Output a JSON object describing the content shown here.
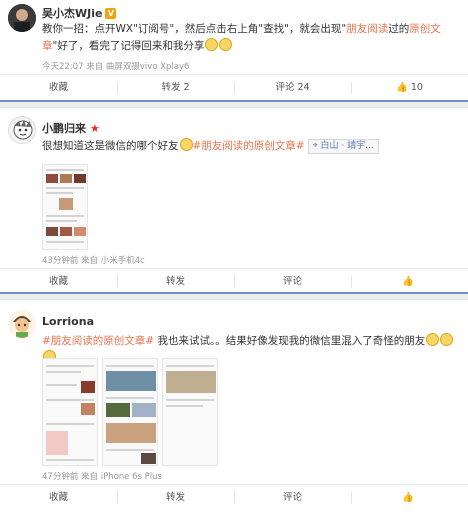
{
  "posts": [
    {
      "user": "吴小杰WJie",
      "badge": "V",
      "text_parts": {
        "a": "教你一招：点开WX\"订阅号\"，然后点击右上角\"查找\"，就会出现\"",
        "hl1": "朋友阅读",
        "b": "过的",
        "hl2": "原创文章",
        "c": "\"好了，看完了记得回来和我分享"
      },
      "meta": "今天22:07 来自 曲屏双摄vivo Xplay6",
      "actions": {
        "fav": "收藏",
        "repost": "转发 2",
        "comment": "评论 24",
        "like": "10"
      }
    },
    {
      "user": "小鹏归来",
      "text_parts": {
        "a": "很想知道这是微信的哪个好友",
        "hashtag": "#朋友阅读的原创文章#",
        "location": "白山 · 靖宇..."
      },
      "meta": "43分钟前 来自 小米手机4c",
      "actions": {
        "fav": "收藏",
        "repost": "转发",
        "comment": "评论",
        "like": ""
      }
    },
    {
      "user": "Lorriona",
      "text_parts": {
        "hashtag": "#朋友阅读的原创文章#",
        "a": " 我也来试试。。结果好像发现我的微信里混入了奇怪的朋友"
      },
      "meta": "47分钟前 来自 iPhone 6s Plus",
      "actions": {
        "fav": "收藏",
        "repost": "转发",
        "comment": "评论",
        "like": ""
      }
    }
  ],
  "colors": {
    "highlight": "#eb7350",
    "link": "#eb7350",
    "separator_accent": "#6d8fc7"
  },
  "icons": {
    "like": "thumbs-up-icon",
    "verified": "verified-v-icon",
    "star": "star-icon",
    "emoji": "doge-emoji-icon",
    "location": "location-pin-icon"
  }
}
